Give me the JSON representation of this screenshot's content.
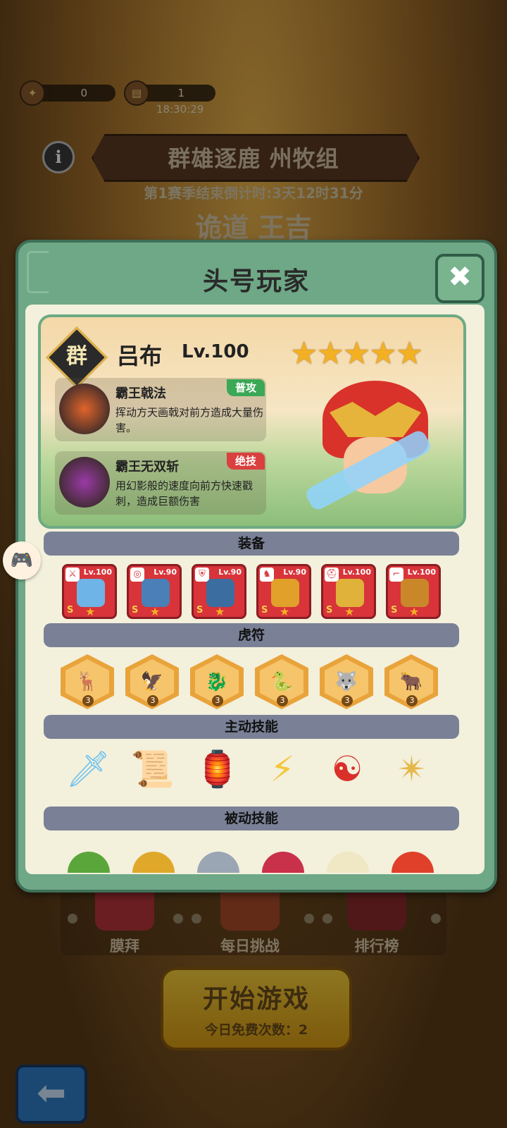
{
  "top_bar": {
    "resource1": {
      "icon": "medal-icon",
      "value": "0"
    },
    "resource2": {
      "icon": "ticket-icon",
      "value": "1"
    },
    "timer": "18:30:29"
  },
  "event": {
    "title": "群雄逐鹿 州牧组",
    "countdown": "第1赛季结束倒计时:3天12时31分",
    "peek_name": "诡道 王吉"
  },
  "bottom_menu": {
    "items": [
      {
        "label": "膜拜",
        "color": "#b7343a"
      },
      {
        "label": "每日挑战",
        "color": "#a84a2a"
      },
      {
        "label": "排行榜",
        "color": "#8a2a2a"
      }
    ],
    "start_button": {
      "title": "开始游戏",
      "subtitle": "今日免费次数：2"
    }
  },
  "modal": {
    "title": "头号玩家",
    "close_symbol": "✖",
    "hero": {
      "faction": "群",
      "name": "吕布",
      "level": "Lv.100",
      "stars": 5,
      "skills": [
        {
          "name": "霸王戟法",
          "tag": "普攻",
          "tag_color": "#3aa856",
          "desc": "挥动方天画戟对前方造成大量伤害。",
          "icon_color": "#e0642a"
        },
        {
          "name": "霸王无双斩",
          "tag": "绝技",
          "tag_color": "#d9403f",
          "desc": "用幻影般的速度向前方快速戳刺，造成巨额伤害",
          "icon_color": "#9a3aa6"
        }
      ]
    },
    "sections": {
      "equipment": "装备",
      "tiger_tally": "虎符",
      "active_skills": "主动技能",
      "passive_skills": "被动技能"
    },
    "equipment": [
      {
        "type": "sword-icon",
        "level": "Lv.100",
        "rank": "S",
        "art_color": "#6fb4e6"
      },
      {
        "type": "medal-icon",
        "level": "Lv.90",
        "rank": "S",
        "art_color": "#4a7fb8"
      },
      {
        "type": "armor-icon",
        "level": "Lv.90",
        "rank": "S",
        "art_color": "#3b6da0"
      },
      {
        "type": "horse-icon",
        "level": "Lv.90",
        "rank": "S",
        "art_color": "#e0a02a"
      },
      {
        "type": "helmet-icon",
        "level": "Lv.100",
        "rank": "S",
        "art_color": "#e0b23a"
      },
      {
        "type": "boot-icon",
        "level": "Lv.100",
        "rank": "S",
        "art_color": "#c9872a"
      }
    ],
    "tiger_tallies": [
      {
        "beast": "deer-icon",
        "level": "3"
      },
      {
        "beast": "eagle-icon",
        "level": "3"
      },
      {
        "beast": "dragon-icon",
        "level": "3"
      },
      {
        "beast": "snake-icon",
        "level": "3"
      },
      {
        "beast": "wolf-icon",
        "level": "3"
      },
      {
        "beast": "ox-icon",
        "level": "3"
      }
    ],
    "active_skills": [
      {
        "icon": "ice-sword-icon",
        "glyph": "🗡",
        "color": "#6fc2ef"
      },
      {
        "icon": "talisman-icon",
        "glyph": "📜",
        "color": "#e6b02a"
      },
      {
        "icon": "brazier-icon",
        "glyph": "🏮",
        "color": "#b56a3a"
      },
      {
        "icon": "lightning-icon",
        "glyph": "⚡",
        "color": "#f4c63a"
      },
      {
        "icon": "yin-yang-icon",
        "glyph": "☯",
        "color": "#d9302a"
      },
      {
        "icon": "shuriken-icon",
        "glyph": "✴",
        "color": "#e6b84a"
      }
    ],
    "passive_skills": [
      {
        "icon": "apple-icon",
        "color": "#5aa63a"
      },
      {
        "icon": "gold-ring-icon",
        "color": "#e0a82a"
      },
      {
        "icon": "shield-icon",
        "color": "#9aa6b4"
      },
      {
        "icon": "cherry-icon",
        "color": "#c9304a"
      },
      {
        "icon": "egg-icon",
        "color": "#f0e8c4"
      },
      {
        "icon": "flame-icon",
        "color": "#e0402a"
      }
    ]
  }
}
